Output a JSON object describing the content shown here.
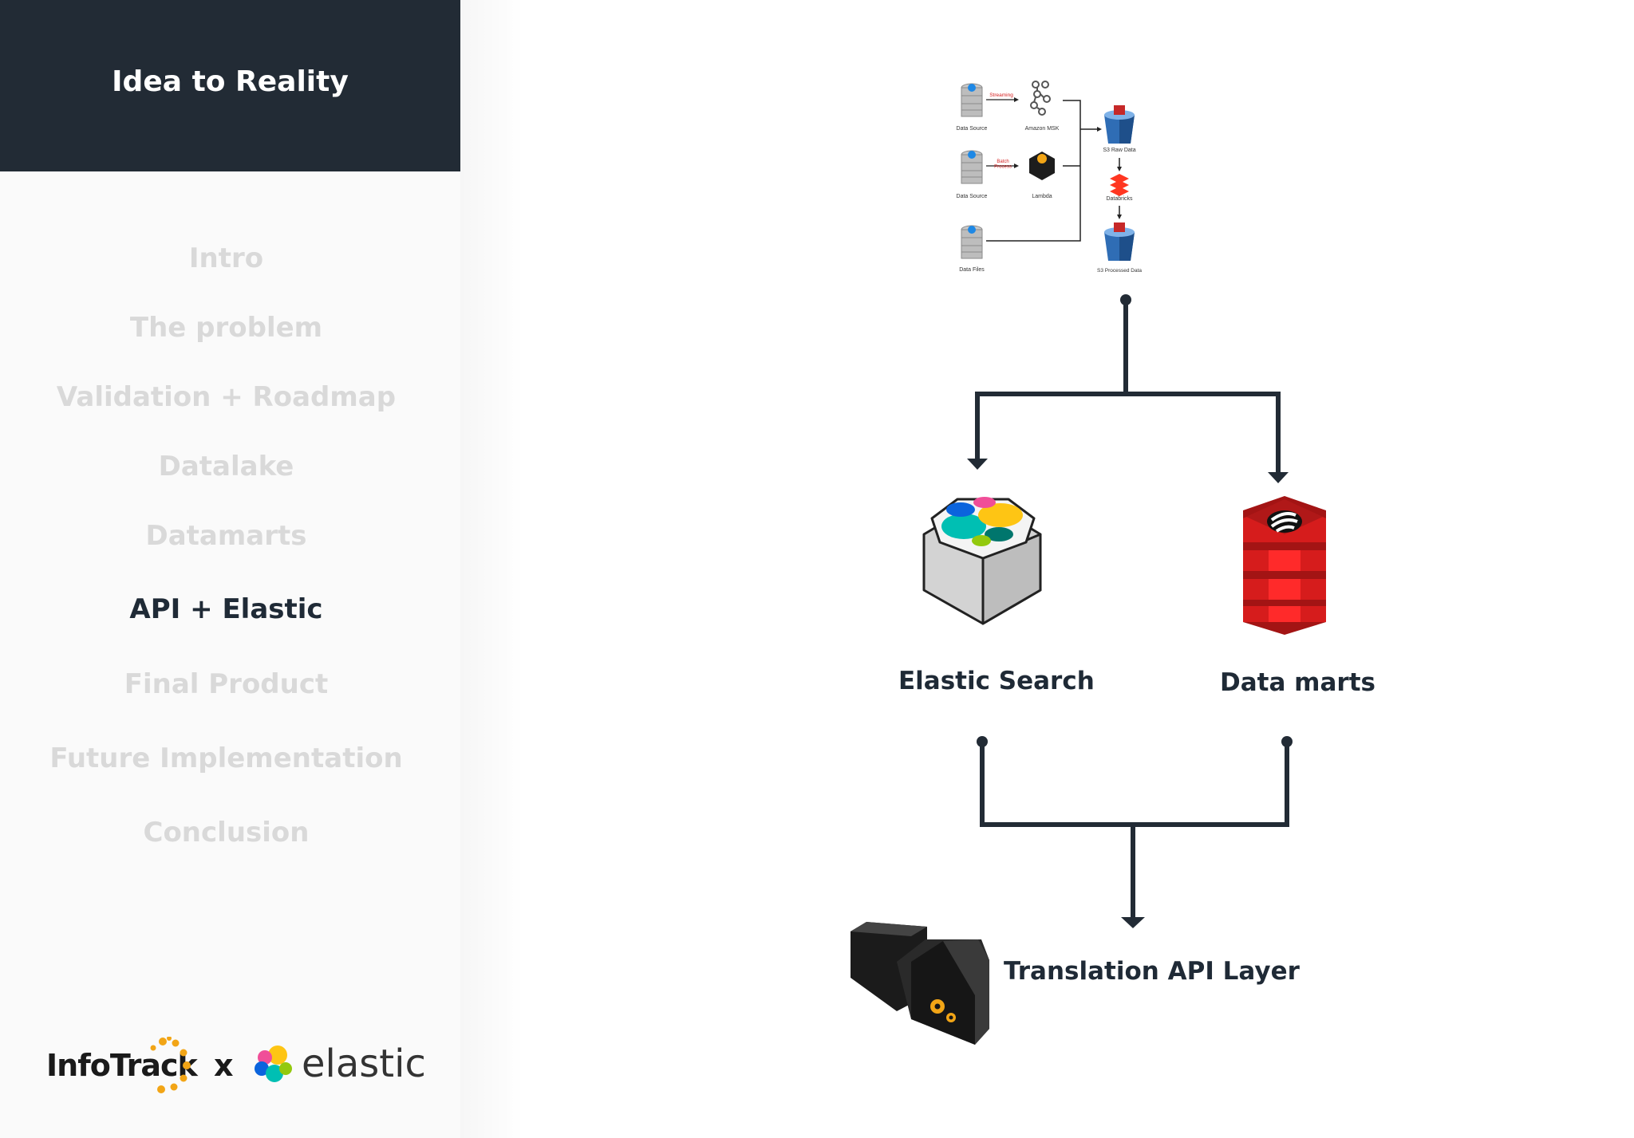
{
  "sidebar": {
    "title": "Idea to Reality",
    "nav": [
      {
        "label": "Intro",
        "active": false
      },
      {
        "label": "The problem",
        "active": false
      },
      {
        "label": "Validation + Roadmap",
        "active": false
      },
      {
        "label": "Datalake",
        "active": false
      },
      {
        "label": "Datamarts",
        "active": false
      },
      {
        "label": "API + Elastic",
        "active": true
      },
      {
        "label": "Final Product",
        "active": false
      },
      {
        "label": "Future Implementation",
        "active": false
      },
      {
        "label": "Conclusion",
        "active": false
      }
    ],
    "logos": {
      "infotrack": "InfoTrack",
      "separator": "x",
      "elastic": "elastic"
    }
  },
  "diagram": {
    "pipeline": {
      "data_source_1": "Data Source",
      "streaming": "Streaming",
      "amazon_msk": "Amazon MSK",
      "data_source_2": "Data Source",
      "batch_process": "Batch\nProcess",
      "lambda": "Lambda",
      "data_files": "Data Files",
      "s3_raw": "S3 Raw Data",
      "databricks": "Databricks",
      "s3_processed": "S3 Processed Data"
    },
    "elastic_search": "Elastic Search",
    "data_marts": "Data marts",
    "translation_api": "Translation API Layer"
  },
  "colors": {
    "sidebar_header": "#222b35",
    "nav_inactive": "#d9d9d9",
    "nav_active": "#1f2a36",
    "line": "#222b35",
    "redis_red": "#d61c1c"
  }
}
